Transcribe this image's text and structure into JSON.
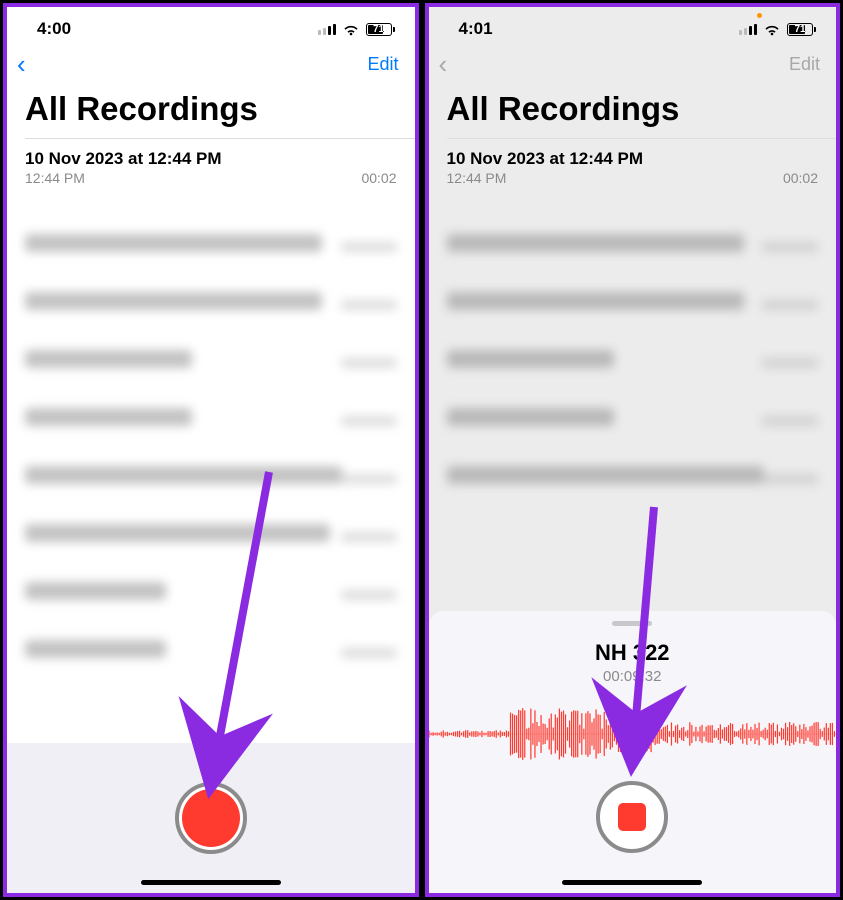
{
  "left": {
    "status": {
      "time": "4:00",
      "battery": "71"
    },
    "nav": {
      "edit": "Edit"
    },
    "title": "All Recordings",
    "recording": {
      "title": "10 Nov 2023 at 12:44 PM",
      "time": "12:44 PM",
      "duration": "00:02"
    }
  },
  "right": {
    "status": {
      "time": "4:01",
      "battery": "71"
    },
    "nav": {
      "edit": "Edit"
    },
    "title": "All Recordings",
    "recording": {
      "title": "10 Nov 2023 at 12:44 PM",
      "time": "12:44 PM",
      "duration": "00:02"
    },
    "sheet": {
      "name": "NH 322",
      "elapsed": "00:09.32"
    }
  },
  "colors": {
    "accent": "#007aff",
    "record": "#ff3b30",
    "annotation": "#8a2be2"
  }
}
